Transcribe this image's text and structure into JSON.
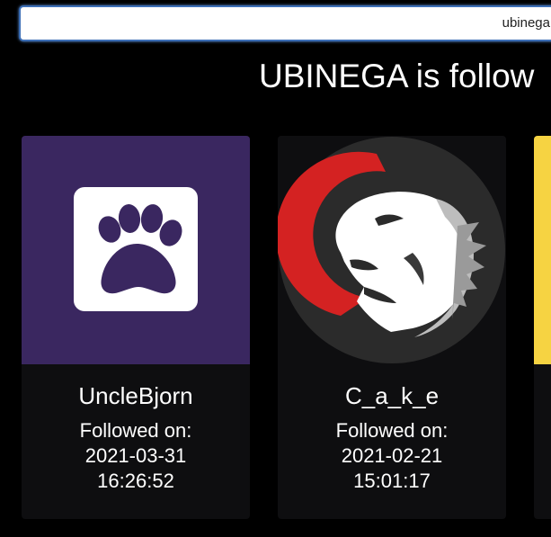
{
  "search": {
    "value": "ubinega"
  },
  "header": {
    "title": "UBINEGA is follow"
  },
  "cards": [
    {
      "name": "UncleBjorn",
      "followed_label": "Followed on:",
      "date": "2021-03-31",
      "time": "16:26:52",
      "avatar_icon": "paw-icon",
      "avatar_bg": "#3a2760"
    },
    {
      "name": "C_a_k_e",
      "followed_label": "Followed on:",
      "date": "2021-02-21",
      "time": "15:01:17",
      "avatar_icon": "lion-icon",
      "avatar_bg": "#2a2a2a"
    },
    {
      "avatar_bg": "#f6d342"
    }
  ],
  "colors": {
    "background": "#000000",
    "card": "#0e0e10",
    "search_border": "#3d6fb6",
    "text": "#ffffff"
  }
}
